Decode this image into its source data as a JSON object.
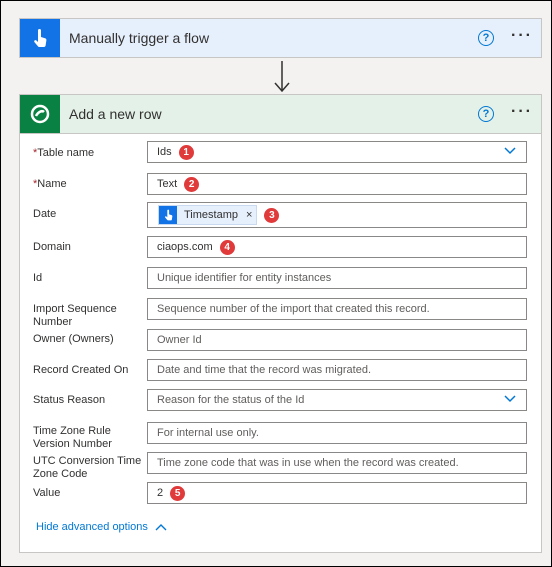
{
  "trigger": {
    "title": "Manually trigger a flow",
    "help": "?",
    "more": "···"
  },
  "action": {
    "title": "Add a new row",
    "help": "?",
    "more": "···"
  },
  "fields": {
    "table_name": {
      "label": "Table name",
      "value": "Ids",
      "badge": "1"
    },
    "name": {
      "label": "Name",
      "value": "Text",
      "badge": "2"
    },
    "date": {
      "label": "Date",
      "token": "Timestamp",
      "token_remove": "×",
      "badge": "3"
    },
    "domain": {
      "label": "Domain",
      "value": "ciaops.com",
      "badge": "4"
    },
    "id": {
      "label": "Id",
      "placeholder": "Unique identifier for entity instances"
    },
    "import_seq": {
      "label": "Import Sequence Number",
      "placeholder": "Sequence number of the import that created this record."
    },
    "owner": {
      "label": "Owner (Owners)",
      "placeholder": "Owner Id"
    },
    "record_created": {
      "label": "Record Created On",
      "placeholder": "Date and time that the record was migrated."
    },
    "status_reason": {
      "label": "Status Reason",
      "placeholder": "Reason for the status of the Id"
    },
    "tz_rule": {
      "label": "Time Zone Rule Version Number",
      "placeholder": "For internal use only."
    },
    "utc_tz": {
      "label": "UTC Conversion Time Zone Code",
      "placeholder": "Time zone code that was in use when the record was created."
    },
    "value": {
      "label": "Value",
      "value": "2",
      "badge": "5"
    }
  },
  "required_marker": "*",
  "advanced_link": "Hide advanced options",
  "colors": {
    "trigger_accent": "#1173e6",
    "dataverse_accent": "#088142",
    "badge": "#e03a3a",
    "link": "#0078d4"
  },
  "icons": {
    "trigger": "touch-hand-icon",
    "action": "dataverse-icon"
  }
}
